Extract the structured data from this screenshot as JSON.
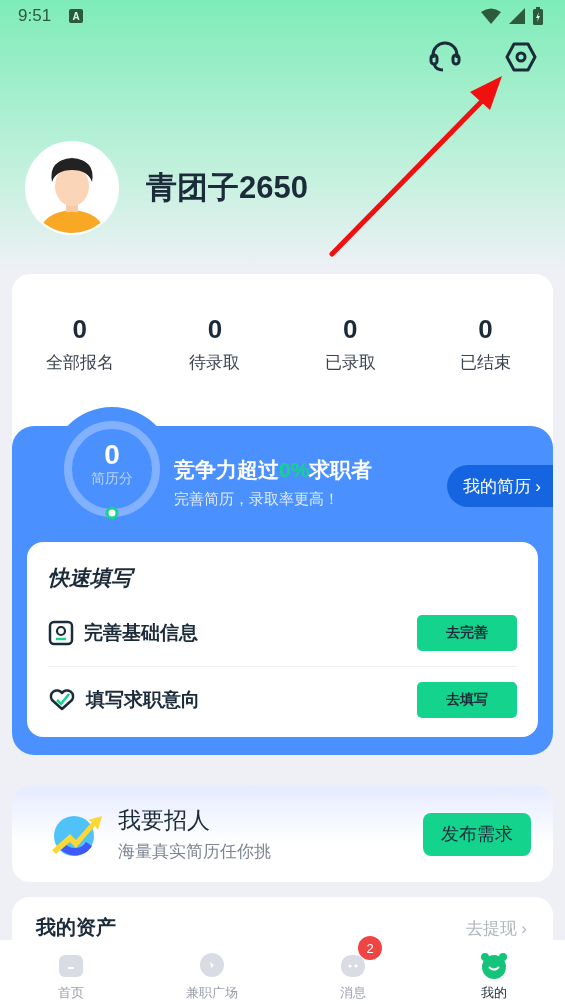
{
  "status_bar": {
    "time": "9:51",
    "notification": "A"
  },
  "profile": {
    "name": "青团子2650"
  },
  "stats": [
    {
      "value": "0",
      "label": "全部报名"
    },
    {
      "value": "0",
      "label": "待录取"
    },
    {
      "value": "0",
      "label": "已录取"
    },
    {
      "value": "0",
      "label": "已结束"
    }
  ],
  "resume": {
    "score": "0",
    "score_label": "简历分",
    "level": 0,
    "title_before": "竞争力超过",
    "title_highlight": "0%",
    "title_after": "求职者",
    "subtitle": "完善简历，录取率更高！",
    "button": "我的简历 ›"
  },
  "quick_fill": {
    "title": "快速填写",
    "items": [
      {
        "kind": "profile",
        "label": "完善基础信息",
        "button": "去完善"
      },
      {
        "kind": "intent",
        "label": "填写求职意向",
        "button": "去填写"
      }
    ]
  },
  "recruit": {
    "title": "我要招人",
    "subtitle": "海量真实简历任你挑",
    "button": "发布需求"
  },
  "assets": {
    "title": "我的资产",
    "link": "去提现 ›"
  },
  "tabs": [
    {
      "kind": "home",
      "label": "首页",
      "selected": false
    },
    {
      "kind": "plaza",
      "label": "兼职广场",
      "selected": false
    },
    {
      "kind": "message",
      "label": "消息",
      "selected": false,
      "badge": "2"
    },
    {
      "kind": "mine",
      "label": "我的",
      "selected": true
    }
  ]
}
